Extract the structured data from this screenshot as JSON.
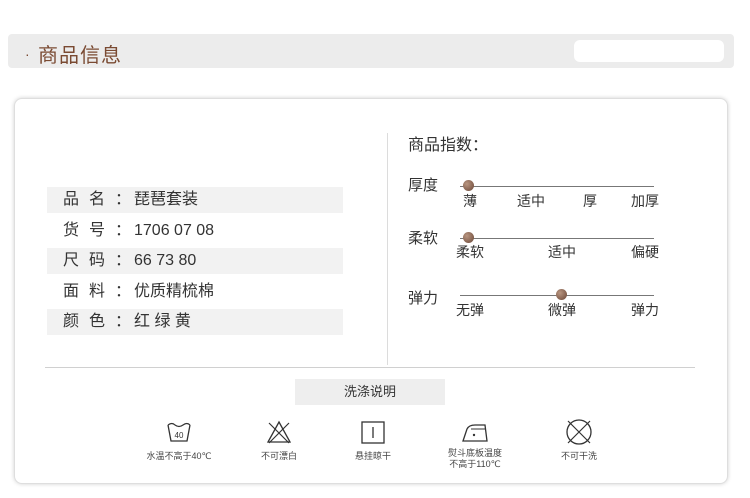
{
  "header": {
    "bullet": "·",
    "title": "商品信息"
  },
  "product_info": [
    {
      "label": "品名：",
      "value": "琵琶套装"
    },
    {
      "label": "货号：",
      "value": "1706 07 08"
    },
    {
      "label": "尺码：",
      "value": "66 73 80"
    },
    {
      "label": "面料：",
      "value": "优质精梳棉"
    },
    {
      "label": "颜色：",
      "value": "红 绿 黄"
    }
  ],
  "index": {
    "title": "商品指数：",
    "scales": [
      {
        "name": "厚度",
        "ticks": [
          "薄",
          "适中",
          "厚",
          "加厚"
        ],
        "selected": "薄"
      },
      {
        "name": "柔软",
        "ticks": [
          "柔软",
          "适中",
          "偏硬"
        ],
        "selected": "柔软"
      },
      {
        "name": "弹力",
        "ticks": [
          "无弹",
          "微弹",
          "弹力"
        ],
        "selected": "微弹"
      }
    ]
  },
  "washing": {
    "title": "洗涤说明",
    "items": [
      {
        "icon": "wash-40-icon",
        "label": "水温不高于40℃",
        "icon_text": "40"
      },
      {
        "icon": "no-bleach-icon",
        "label": "不可漂白"
      },
      {
        "icon": "hang-dry-icon",
        "label": "悬挂晾干"
      },
      {
        "icon": "iron-icon",
        "label_line1": "熨斗底板温度",
        "label_line2": "不高于110℃"
      },
      {
        "icon": "no-tumble-dry-icon",
        "label": "不可干洗"
      }
    ]
  },
  "colors": {
    "accent": "#7a4a32",
    "dot": "#6a4636"
  }
}
